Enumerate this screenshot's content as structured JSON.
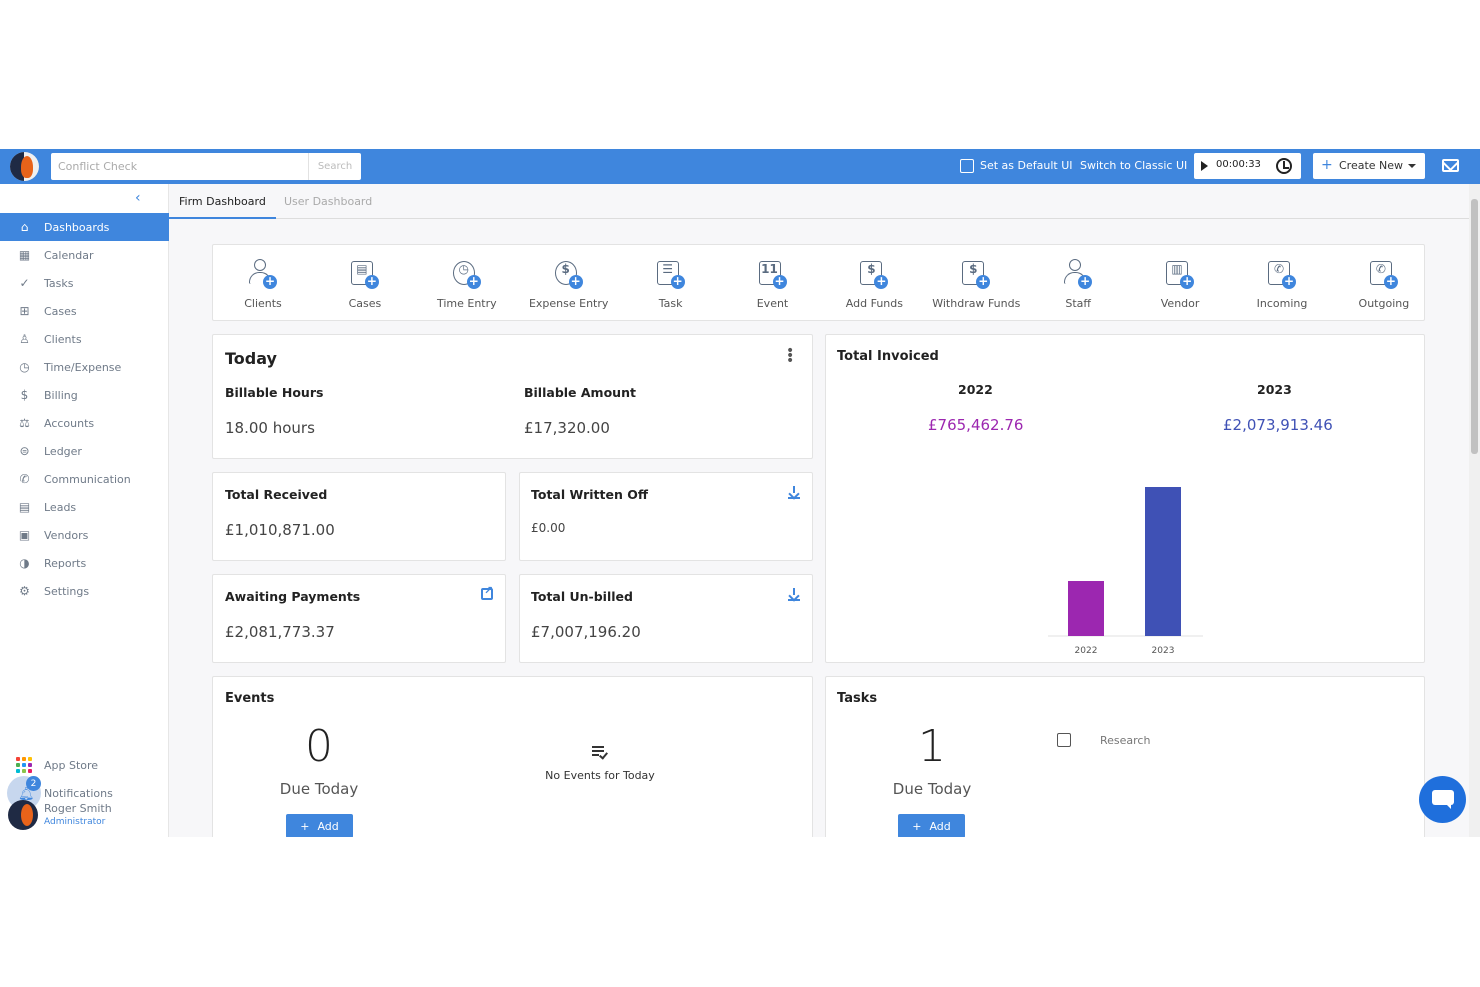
{
  "topbar": {
    "search_placeholder": "Conflict Check",
    "search_button": "Search",
    "set_default": "Set as Default UI",
    "switch_classic": "Switch to Classic UI",
    "timer": "00:00:33",
    "create_new": "Create New"
  },
  "sidebar": {
    "items": [
      {
        "label": "Dashboards",
        "icon": "home-icon",
        "glyph": "⌂"
      },
      {
        "label": "Calendar",
        "icon": "calendar-icon",
        "glyph": "▦"
      },
      {
        "label": "Tasks",
        "icon": "tasks-icon",
        "glyph": "✓"
      },
      {
        "label": "Cases",
        "icon": "briefcase-icon",
        "glyph": "⊞"
      },
      {
        "label": "Clients",
        "icon": "clients-icon",
        "glyph": "♙"
      },
      {
        "label": "Time/Expense",
        "icon": "time-icon",
        "glyph": "◷"
      },
      {
        "label": "Billing",
        "icon": "billing-icon",
        "glyph": "$"
      },
      {
        "label": "Accounts",
        "icon": "accounts-icon",
        "glyph": "⚖"
      },
      {
        "label": "Ledger",
        "icon": "ledger-icon",
        "glyph": "⊜"
      },
      {
        "label": "Communication",
        "icon": "phone-icon",
        "glyph": "✆"
      },
      {
        "label": "Leads",
        "icon": "leads-icon",
        "glyph": "▤"
      },
      {
        "label": "Vendors",
        "icon": "vendors-icon",
        "glyph": "▣"
      },
      {
        "label": "Reports",
        "icon": "reports-icon",
        "glyph": "◑"
      },
      {
        "label": "Settings",
        "icon": "settings-icon",
        "glyph": "⚙"
      }
    ],
    "app_store": "App Store",
    "notifications": "Notifications",
    "notification_count": "2",
    "user_name": "Roger Smith",
    "user_role": "Administrator"
  },
  "tabs": [
    "Firm Dashboard",
    "User Dashboard"
  ],
  "quick_actions": [
    {
      "label": "Clients",
      "icon": "add-client-icon"
    },
    {
      "label": "Cases",
      "icon": "add-case-icon"
    },
    {
      "label": "Time Entry",
      "icon": "add-time-entry-icon"
    },
    {
      "label": "Expense Entry",
      "icon": "add-expense-icon"
    },
    {
      "label": "Task",
      "icon": "add-task-icon"
    },
    {
      "label": "Event",
      "icon": "add-event-icon"
    },
    {
      "label": "Add Funds",
      "icon": "add-funds-icon"
    },
    {
      "label": "Withdraw Funds",
      "icon": "withdraw-funds-icon"
    },
    {
      "label": "Staff",
      "icon": "add-staff-icon"
    },
    {
      "label": "Vendor",
      "icon": "add-vendor-icon"
    },
    {
      "label": "Incoming",
      "icon": "incoming-call-icon"
    },
    {
      "label": "Outgoing",
      "icon": "outgoing-call-icon"
    }
  ],
  "today": {
    "title": "Today",
    "billable_hours_label": "Billable Hours",
    "billable_hours": "18.00 hours",
    "billable_amount_label": "Billable Amount",
    "billable_amount": "£17,320.00"
  },
  "received": {
    "label": "Total Received",
    "value": "£1,010,871.00"
  },
  "written_off": {
    "label": "Total Written Off",
    "value": "£0.00"
  },
  "awaiting": {
    "label": "Awaiting Payments",
    "value": "£2,081,773.37"
  },
  "unbilled": {
    "label": "Total Un-billed",
    "value": "£7,007,196.20"
  },
  "invoiced": {
    "title": "Total Invoiced",
    "year1": "2022",
    "value1": "£765,462.76",
    "year2": "2023",
    "value2": "£2,073,913.46"
  },
  "chart_data": {
    "type": "bar",
    "title": "",
    "categories": [
      "2022",
      "2023"
    ],
    "values": [
      765462.76,
      2073913.46
    ],
    "colors": [
      "#9c27b0",
      "#3f51b5"
    ],
    "ylim": [
      0,
      2073913.46
    ],
    "grid": false
  },
  "events": {
    "title": "Events",
    "count": "0",
    "due": "Due Today",
    "empty": "No Events for Today",
    "add": "Add"
  },
  "tasks": {
    "title": "Tasks",
    "count": "1",
    "due": "Due Today",
    "item": "Research",
    "add": "Add"
  },
  "colors": {
    "accent": "#3f86dd",
    "purple": "#9c27b0",
    "indigo": "#3f51b5"
  }
}
